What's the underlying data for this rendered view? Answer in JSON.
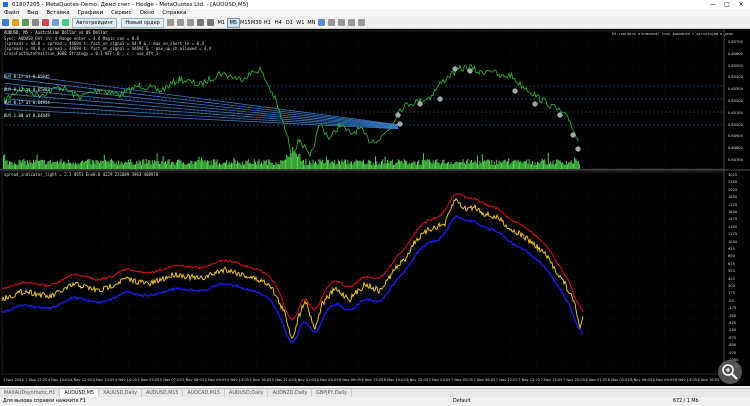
{
  "window": {
    "title": "61807205 - MetaQuotes-Demo: Демо счет - Hedge - MetaQuotes Ltd. - [AUDUSD,M5]",
    "minimize": "—",
    "maximize": "□",
    "close": "✕"
  },
  "menu": [
    "Файл",
    "Вид",
    "Вставка",
    "Графики",
    "Сервис",
    "Окно",
    "Справка"
  ],
  "toolbar": {
    "algo_label": "Автотрейдинг",
    "new_order_label": "Новый ордер",
    "timeframes": [
      "M1",
      "M5",
      "M15",
      "M30",
      "H1",
      "H4",
      "D1",
      "W1",
      "MN"
    ],
    "active_timeframe": "M5"
  },
  "chart": {
    "symbol_line": "AUDUSD, M5 · Australian Dollar vs US Dollar",
    "notice": "EA торговля отключена: стоп выключен с детектором в день",
    "params": [
      "Sync: AUDUSD_DAY (h) 4 Range enter = 4.4 Magic con = 8.8",
      "[spread] = 44.0 = spread = 44694 t: fact_on_signal = 44.9 & : max_on_short_in = 0.4",
      "[spread] = 44.0 = spread = 44694 t: fact_on_signal = 44694 & : max_up_ch_allowed = 4.4",
      "CrossFactAutoPositive_3000 Strategy = 0.1 NFF: 0 ; c : use_dft_3"
    ],
    "levels": [
      "BUY 0.17 at 0.65045",
      "BUY 0.17 at 0.65003",
      "BUY 0.17 at 0.64954",
      "BUY 1.00 at 0.64849"
    ],
    "indicator_label": "spread_indicator_light  = 2.3  4951  Ene0.6  4229  231089  3963  408978",
    "price_axis_top": [
      "0.65700",
      "0.65600",
      "0.65500",
      "0.65400",
      "0.65300",
      "0.65200",
      "0.65100",
      "0.65000",
      "0.64900",
      "0.64800",
      "0.64700"
    ],
    "price_axis_bottom": [
      "3025",
      "2150",
      "2025",
      "1850",
      "1725",
      "1600",
      "1475",
      "1300",
      "1175",
      "1050",
      "925",
      "800",
      "675",
      "550",
      "425",
      "300",
      "175",
      "-50",
      "-175",
      "-300",
      "-425",
      "-550",
      "-675",
      "-800",
      "-925",
      "-1050",
      "-1175"
    ],
    "time_axis": [
      "1 Nov 2024",
      "1 Nov 12:25",
      "4 Nov 10:05",
      "4 Nov 12:50",
      "4 Nov 13:05",
      "4 Nov 14:05",
      "5 Nov 03:05",
      "5 Nov 07:05",
      "5 Nov 08:05",
      "5 Nov 09:05",
      "5 Nov 13:05",
      "5 Nov 16:05",
      "5 Nov 21:05",
      "6 Nov 01:05",
      "6 Nov 05:05",
      "6 Nov 09:05",
      "6 Nov 13:05",
      "6 Nov 19:05",
      "6 Nov 23:05",
      "7 Nov 03:05",
      "7 Nov 05:05",
      "7 Nov 08:05",
      "7 Nov 12:05",
      "7 Nov 13:25",
      "7 Nov 15:05",
      "7 Nov 20:05",
      "8 Nov 01:05",
      "8 Nov 03:05",
      "8 Nov 06:05",
      "8 Nov 09:05",
      "8 Nov 13:05",
      "8 Nov 16:05"
    ]
  },
  "tabs": [
    "MAXAUDsynthetic,H1",
    "AUDUSD,M5",
    "XAUUSD,Daily",
    "AUDUSD,M15",
    "AUDCAD,M15",
    "AUDUSD,Daily",
    "AUDNZD,Daily",
    "GBPJPY,Daily"
  ],
  "active_tab": "AUDUSD,M5",
  "status": {
    "help": "Для вызова справки нажмите F1",
    "profile": "Default",
    "traffic": "672 / 1 Mb"
  },
  "colors": {
    "price_line": "#2fbf2f",
    "volume": "#4cd04c",
    "upper_band": "#e01010",
    "mid_line": "#ffd21a",
    "lower_band": "#1a1ae6",
    "hedge_lines": "#3f8fe8",
    "accent": "#1b6fd6"
  }
}
